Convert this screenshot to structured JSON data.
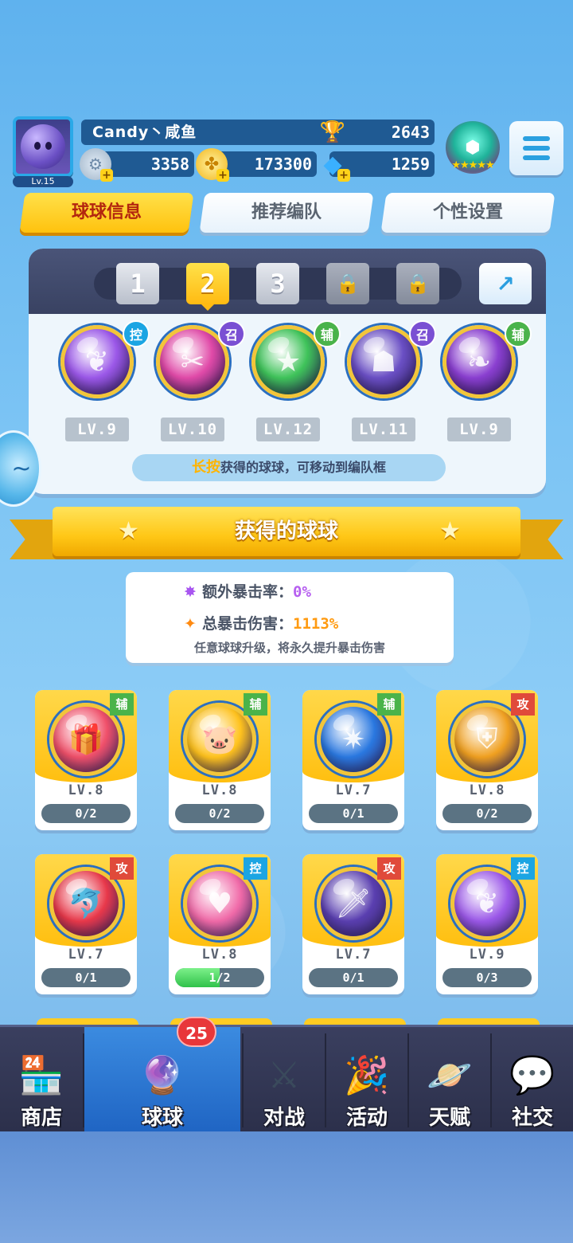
{
  "player": {
    "name": "Candy丶咸鱼",
    "level": "Lv.15",
    "trophies": "2643",
    "silver": "3358",
    "coins": "173300",
    "gems": "1259"
  },
  "tabs": [
    "球球信息",
    "推荐编队",
    "个性设置"
  ],
  "team": {
    "slots": [
      "1",
      "2",
      "3"
    ],
    "active_slot": 2,
    "balls": [
      {
        "role": "控",
        "level": "LV.9",
        "color": "#9b58e8"
      },
      {
        "role": "召",
        "level": "LV.10",
        "color": "#e04aa8"
      },
      {
        "role": "辅",
        "level": "LV.12",
        "color": "#3fc35a"
      },
      {
        "role": "召",
        "level": "LV.11",
        "color": "#6a4fc4"
      },
      {
        "role": "辅",
        "level": "LV.9",
        "color": "#8a3fd0"
      }
    ],
    "hint_highlight": "长按",
    "hint_rest": "获得的球球，可移动到编队框"
  },
  "section_title": "获得的球球",
  "crit": {
    "extra_rate_label": "额外暴击率：",
    "extra_rate_value": "0%",
    "total_damage_label": "总暴击伤害：",
    "total_damage_value": "1113%",
    "note": "任意球球升级，将永久提升暴击伤害"
  },
  "owned": [
    {
      "role": "辅",
      "level": "LV.8",
      "progress": "0/2",
      "fill": 0,
      "color": "#f0506a"
    },
    {
      "role": "辅",
      "level": "LV.8",
      "progress": "0/2",
      "fill": 0,
      "color": "#ffc21d"
    },
    {
      "role": "辅",
      "level": "LV.7",
      "progress": "0/1",
      "fill": 0,
      "color": "#2a78e0"
    },
    {
      "role": "攻",
      "level": "LV.8",
      "progress": "0/2",
      "fill": 0,
      "color": "#f0a020"
    },
    {
      "role": "攻",
      "level": "LV.7",
      "progress": "0/1",
      "fill": 0,
      "color": "#e8384a"
    },
    {
      "role": "控",
      "level": "LV.8",
      "progress": "1/2",
      "fill": 0.5,
      "color": "#f06aa8"
    },
    {
      "role": "攻",
      "level": "LV.7",
      "progress": "0/1",
      "fill": 0,
      "color": "#5a3fb0"
    },
    {
      "role": "控",
      "level": "LV.9",
      "progress": "0/3",
      "fill": 0,
      "color": "#9b58e8"
    }
  ],
  "nav": {
    "items": [
      "商店",
      "球球",
      "对战",
      "活动",
      "天赋",
      "社交"
    ],
    "active": "球球",
    "badge": "25"
  }
}
